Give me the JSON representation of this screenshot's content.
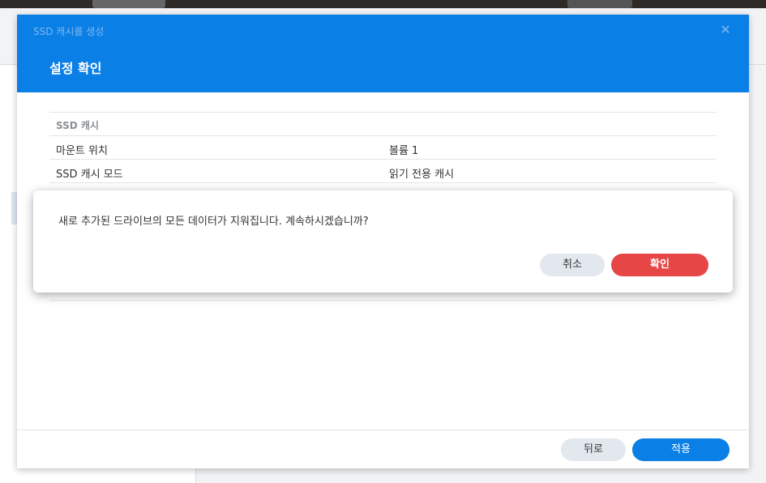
{
  "dialog": {
    "title": "SSD 캐시를 생성",
    "close_icon": "close-icon",
    "step_title": "설정 확인",
    "summary": {
      "section_label": "SSD 캐시",
      "rows": [
        {
          "key": "마운트 위치",
          "value": "볼륨 1"
        },
        {
          "key": "SSD 캐시 모드",
          "value": "읽기 전용 캐시"
        }
      ]
    },
    "footer": {
      "back_label": "뒤로",
      "apply_label": "적용"
    }
  },
  "confirm": {
    "message": "새로 추가된 드라이브의 모든 데이터가 지워집니다. 계속하시겠습니까?",
    "cancel_label": "취소",
    "ok_label": "확인"
  },
  "colors": {
    "header_blue": "#0a7fe6",
    "danger_red": "#e64646"
  }
}
